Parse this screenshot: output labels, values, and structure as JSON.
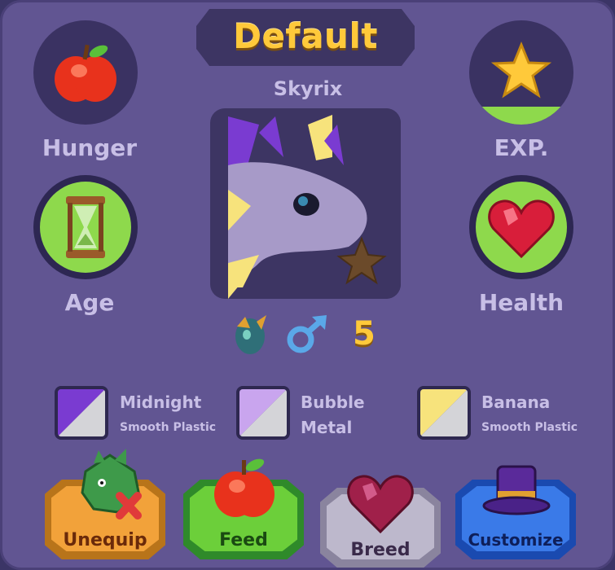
{
  "title": "Default",
  "pet_name": "Skyrix",
  "stats": {
    "hunger": "Hunger",
    "exp": "EXP.",
    "age": "Age",
    "health": "Health"
  },
  "level": "5",
  "colors": [
    {
      "name": "Midnight",
      "material": "Smooth Plastic",
      "color": "#7a3bd1"
    },
    {
      "name": "Bubble",
      "material": "Metal",
      "color": "#c9a5ee"
    },
    {
      "name": "Banana",
      "material": "Smooth Plastic",
      "color": "#f7e37c"
    }
  ],
  "actions": {
    "unequip": "Unequip",
    "feed": "Feed",
    "breed": "Breed",
    "customize": "Customize"
  },
  "icons": [
    "apple-icon",
    "star-icon",
    "hourglass-icon",
    "heart-icon",
    "dragon-egg-icon",
    "male-icon",
    "dragon-icon",
    "top-hat-icon"
  ]
}
